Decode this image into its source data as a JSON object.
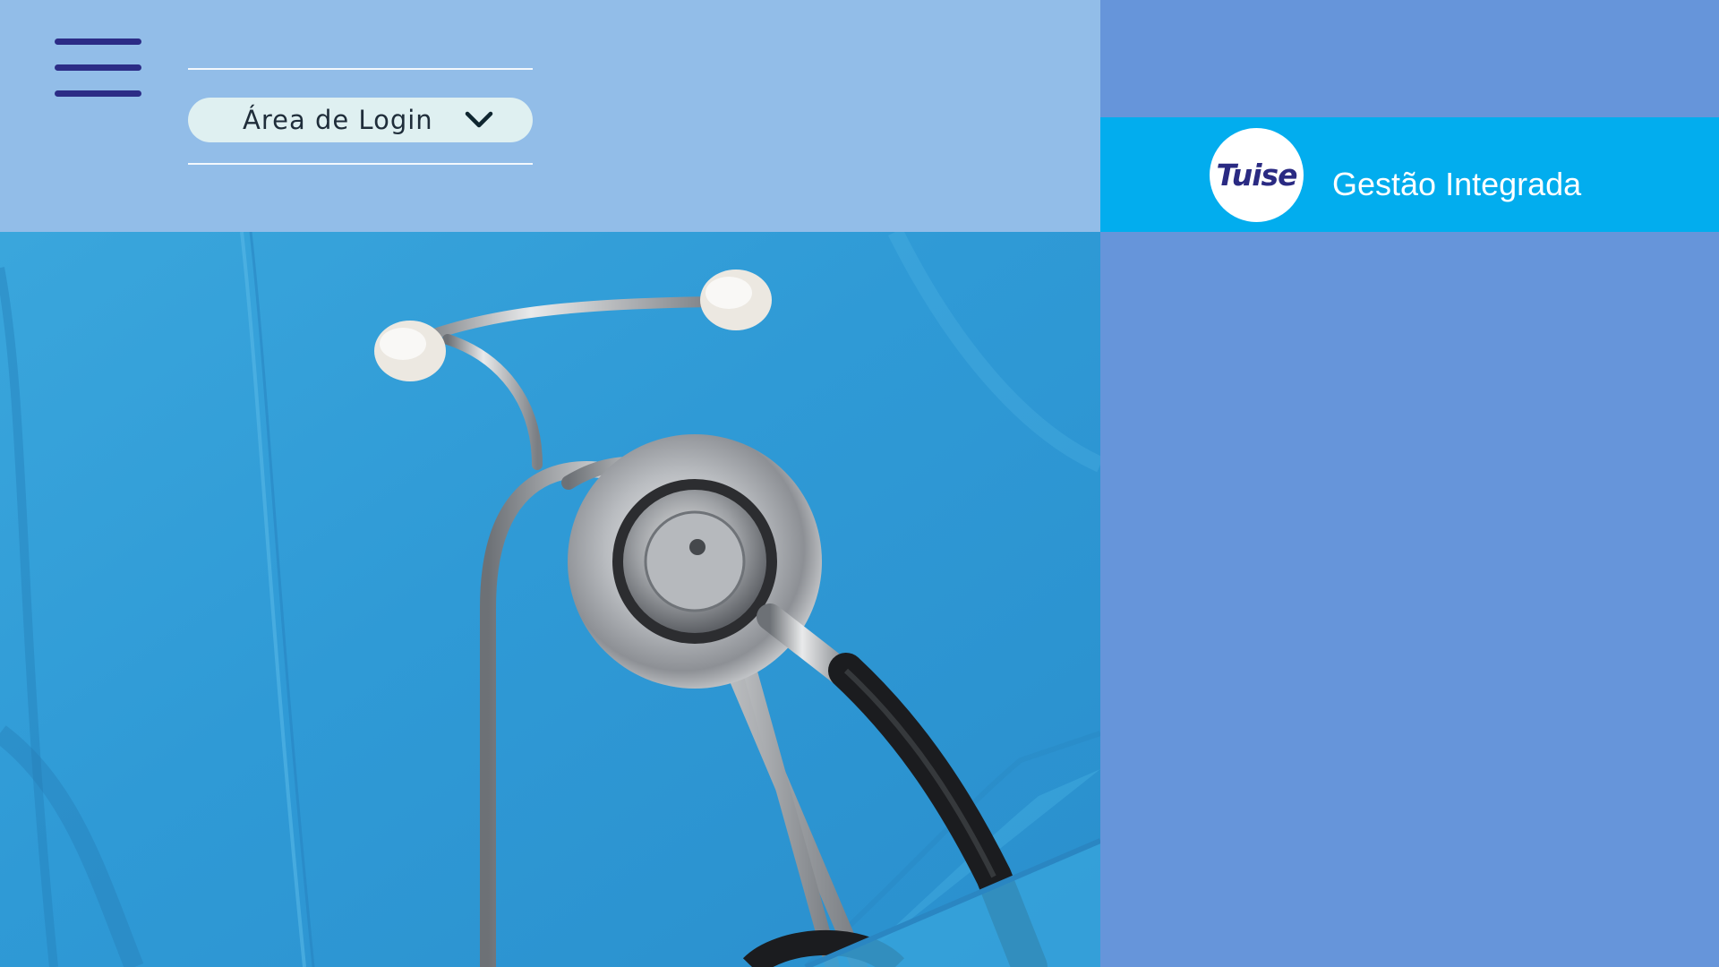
{
  "header": {
    "menu_icon": "hamburger-menu-icon",
    "login_dropdown": {
      "label": "Área de Login",
      "icon": "chevron-down-icon"
    }
  },
  "brand": {
    "logo_text": "Tuise",
    "tagline": "Gestão Integrada"
  },
  "hero": {
    "image_subject": "stethoscope-on-blue-scrubs"
  },
  "colors": {
    "left_header_bg": "#92bde8",
    "page_bg": "#6695da",
    "brand_band": "#02adee",
    "menu_bars": "#2c2c86",
    "login_pill": "#dff0f1",
    "logo_text": "#2a2a82"
  }
}
